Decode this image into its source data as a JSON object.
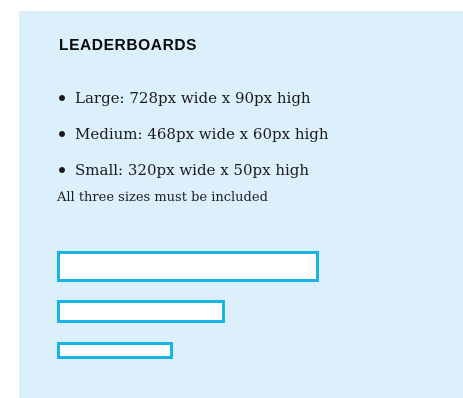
{
  "panel": {
    "heading": "LEADERBOARDS",
    "sizes": [
      {
        "label": "Large: 728px wide x 90px high"
      },
      {
        "label": "Medium: 468px wide x 60px high"
      },
      {
        "label": "Small: 320px wide x 50px high"
      }
    ],
    "note": "All three sizes must be included",
    "accent_color": "#18b4e8",
    "background_color": "#dcf0fb"
  }
}
